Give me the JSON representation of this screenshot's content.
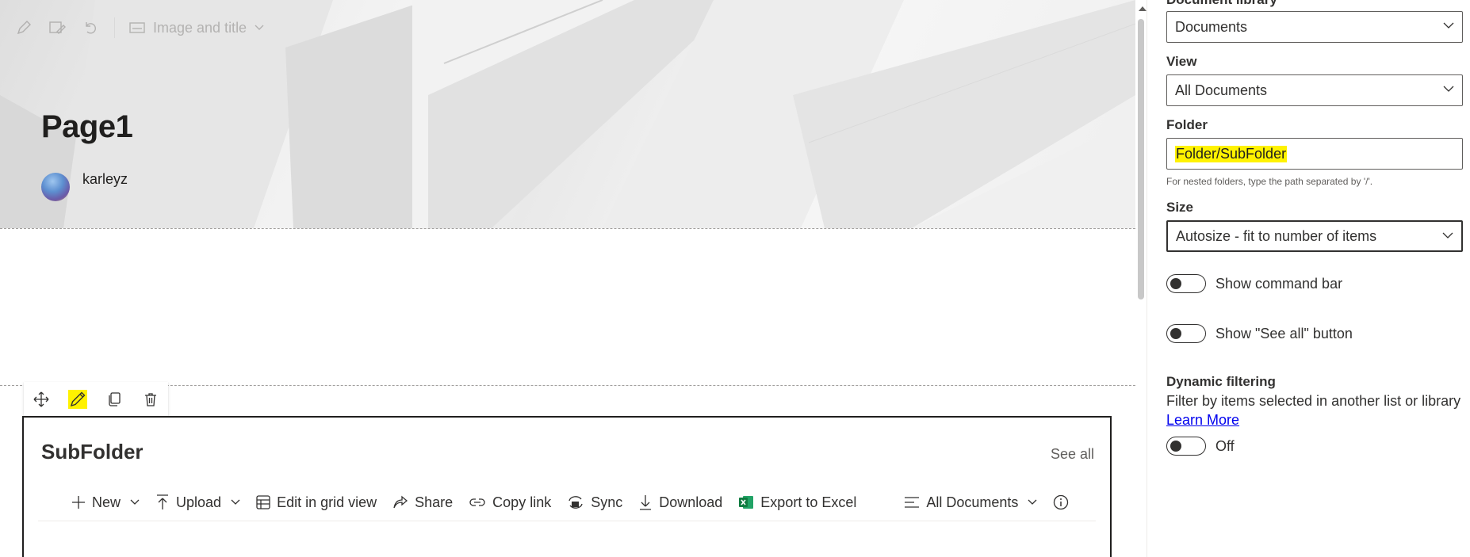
{
  "hero": {
    "toolbar": {
      "layout_label": "Image and title"
    },
    "title": "Page1",
    "author": "karleyz"
  },
  "webpart": {
    "title": "SubFolder",
    "see_all": "See all",
    "commands": [
      {
        "label": "New"
      },
      {
        "label": "Upload"
      },
      {
        "label": "Edit in grid view"
      },
      {
        "label": "Share"
      },
      {
        "label": "Copy link"
      },
      {
        "label": "Sync"
      },
      {
        "label": "Download"
      },
      {
        "label": "Export to Excel"
      }
    ],
    "view_label": "All Documents"
  },
  "pane": {
    "doc_library_label": "Document library",
    "doc_library_value": "Documents",
    "view_label": "View",
    "view_value": "All Documents",
    "folder_label": "Folder",
    "folder_value": "Folder/SubFolder",
    "folder_help": "For nested folders, type the path separated by '/'.",
    "size_label": "Size",
    "size_value": "Autosize - fit to number of items",
    "show_command_bar": "Show command bar",
    "show_see_all": "Show \"See all\" button",
    "dynamic_title": "Dynamic filtering",
    "dynamic_desc": "Filter by items selected in another list or library",
    "learn_more": "Learn More",
    "dynamic_state": "Off"
  },
  "colors": {
    "highlight": "#fff200",
    "excel_green": "#107c41",
    "link": "#0000ee"
  }
}
